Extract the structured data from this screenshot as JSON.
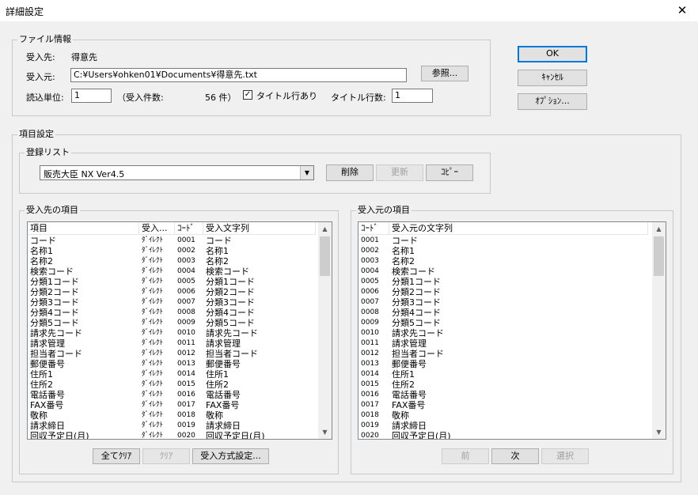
{
  "window": {
    "title": "詳細設定",
    "close": "✕"
  },
  "file_info": {
    "legend": "ファイル情報",
    "dest_label": "受入先:",
    "dest_value": "得意先",
    "src_label": "受入元:",
    "src_path": "C:¥Users¥ohken01¥Documents¥得意先.txt",
    "browse": "参照...",
    "unit_label": "読込単位:",
    "unit_value": "1",
    "count_label": "（受入件数:",
    "count_value": "56 件）",
    "title_row_checkbox": "タイトル行あり",
    "title_row_checked": true,
    "title_rows_label": "タイトル行数:",
    "title_rows_value": "1"
  },
  "dialog_buttons": {
    "ok": "OK",
    "cancel": "ｷｬﾝｾﾙ",
    "options": "ｵﾌﾟｼｮﾝ..."
  },
  "item_settings": {
    "legend": "項目設定",
    "registry": {
      "legend": "登録リスト",
      "selected": "販売大臣 NX Ver4.5",
      "delete": "削除",
      "update": "更新",
      "copy": "ｺﾋﾟｰ"
    },
    "dest_items": {
      "legend": "受入先の項目",
      "columns": [
        "項目",
        "受入...",
        "ｺｰﾄﾞ",
        "受入文字列"
      ],
      "rows": [
        [
          "コード",
          "ﾀﾞｲﾚｸﾄ",
          "0001",
          "コード"
        ],
        [
          "名称1",
          "ﾀﾞｲﾚｸﾄ",
          "0002",
          "名称1"
        ],
        [
          "名称2",
          "ﾀﾞｲﾚｸﾄ",
          "0003",
          "名称2"
        ],
        [
          "検索コード",
          "ﾀﾞｲﾚｸﾄ",
          "0004",
          "検索コード"
        ],
        [
          "分類1コード",
          "ﾀﾞｲﾚｸﾄ",
          "0005",
          "分類1コード"
        ],
        [
          "分類2コード",
          "ﾀﾞｲﾚｸﾄ",
          "0006",
          "分類2コード"
        ],
        [
          "分類3コード",
          "ﾀﾞｲﾚｸﾄ",
          "0007",
          "分類3コード"
        ],
        [
          "分類4コード",
          "ﾀﾞｲﾚｸﾄ",
          "0008",
          "分類4コード"
        ],
        [
          "分類5コード",
          "ﾀﾞｲﾚｸﾄ",
          "0009",
          "分類5コード"
        ],
        [
          "請求先コード",
          "ﾀﾞｲﾚｸﾄ",
          "0010",
          "請求先コード"
        ],
        [
          "請求管理",
          "ﾀﾞｲﾚｸﾄ",
          "0011",
          "請求管理"
        ],
        [
          "担当者コード",
          "ﾀﾞｲﾚｸﾄ",
          "0012",
          "担当者コード"
        ],
        [
          "郵便番号",
          "ﾀﾞｲﾚｸﾄ",
          "0013",
          "郵便番号"
        ],
        [
          "住所1",
          "ﾀﾞｲﾚｸﾄ",
          "0014",
          "住所1"
        ],
        [
          "住所2",
          "ﾀﾞｲﾚｸﾄ",
          "0015",
          "住所2"
        ],
        [
          "電話番号",
          "ﾀﾞｲﾚｸﾄ",
          "0016",
          "電話番号"
        ],
        [
          "FAX番号",
          "ﾀﾞｲﾚｸﾄ",
          "0017",
          "FAX番号"
        ],
        [
          "敬称",
          "ﾀﾞｲﾚｸﾄ",
          "0018",
          "敬称"
        ],
        [
          "請求締日",
          "ﾀﾞｲﾚｸﾄ",
          "0019",
          "請求締日"
        ],
        [
          "回収予定日(月)",
          "ﾀﾞｲﾚｸﾄ",
          "0020",
          "回収予定日(月)"
        ]
      ],
      "clear_all": "全てｸﾘｱ",
      "clear": "ｸﾘｱ",
      "method": "受入方式設定..."
    },
    "src_items": {
      "legend": "受入元の項目",
      "columns": [
        "ｺｰﾄﾞ",
        "受入元の文字列"
      ],
      "rows": [
        [
          "0001",
          "コード"
        ],
        [
          "0002",
          "名称1"
        ],
        [
          "0003",
          "名称2"
        ],
        [
          "0004",
          "検索コード"
        ],
        [
          "0005",
          "分類1コード"
        ],
        [
          "0006",
          "分類2コード"
        ],
        [
          "0007",
          "分類3コード"
        ],
        [
          "0008",
          "分類4コード"
        ],
        [
          "0009",
          "分類5コード"
        ],
        [
          "0010",
          "請求先コード"
        ],
        [
          "0011",
          "請求管理"
        ],
        [
          "0012",
          "担当者コード"
        ],
        [
          "0013",
          "郵便番号"
        ],
        [
          "0014",
          "住所1"
        ],
        [
          "0015",
          "住所2"
        ],
        [
          "0016",
          "電話番号"
        ],
        [
          "0017",
          "FAX番号"
        ],
        [
          "0018",
          "敬称"
        ],
        [
          "0019",
          "請求締日"
        ],
        [
          "0020",
          "回収予定日(月)"
        ]
      ],
      "prev": "前",
      "next": "次",
      "select": "選択"
    }
  }
}
